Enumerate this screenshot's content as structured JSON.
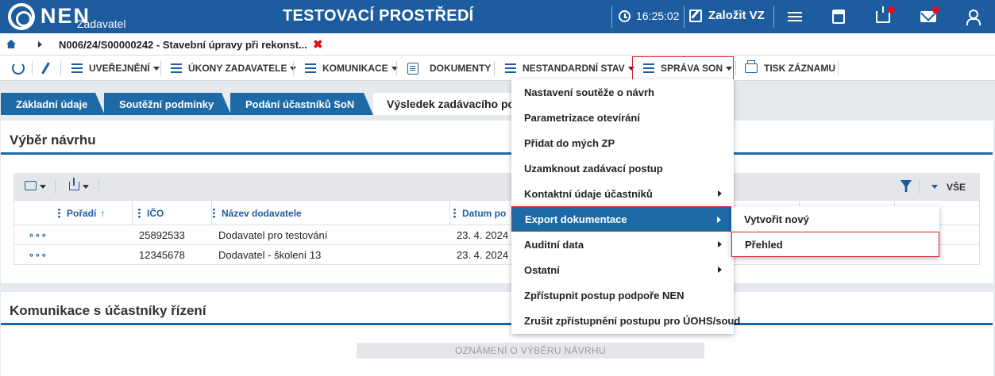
{
  "header": {
    "logo": "NEN",
    "logo_sub": "Zadavatel",
    "env_title": "TESTOVACÍ PROSTŘEDÍ",
    "time": "16:25:02",
    "create_vz": "Založit VZ",
    "icons": [
      "clock-icon",
      "edit-icon",
      "menu-icon",
      "calculator-icon",
      "inbox-icon",
      "mail-icon",
      "user-icon"
    ],
    "accent_color": "#1d5c9e",
    "notification_color": "#e0101c"
  },
  "breadcrumb": {
    "text": "N006/24/S00000242 - Stavební úpravy při rekonst...",
    "close": "✖"
  },
  "toolbar": {
    "uverejneni": "UVEŘEJNĚNÍ",
    "ukony": "ÚKONY ZADAVATELE",
    "komunikace": "KOMUNIKACE",
    "dokumenty": "DOKUMENTY",
    "nestandardni": "NESTANDARDNÍ STAV",
    "sprava": "SPRÁVA SON",
    "tisk": "TISK ZÁZNAMU"
  },
  "tabs": [
    {
      "label": "Základní údaje"
    },
    {
      "label": "Soutěžní podmínky"
    },
    {
      "label": "Podání účastníků SoN"
    },
    {
      "label": "Výsledek zadávacího po"
    }
  ],
  "section1": {
    "title": "Výběr návrhu",
    "filter_all": "VŠE",
    "columns": [
      "Pořadí",
      "IČO",
      "Název dodavatele",
      "Datum po"
    ],
    "rows": [
      {
        "actions": "∘∘∘",
        "ico": "25892533",
        "name": "Dodavatel pro testování",
        "date": "23. 4. 2024"
      },
      {
        "actions": "∘∘∘",
        "ico": "12345678",
        "name": "Dodavatel - školení 13",
        "date": "23. 4. 2024"
      }
    ]
  },
  "section2": {
    "title": "Komunikace s účastníky řízení",
    "button": "OZNÁMENÍ O VÝBĚRU NÁVRHU"
  },
  "menu": {
    "items": [
      {
        "label": "Nastavení soutěže o návrh",
        "arrow": false
      },
      {
        "label": "Parametrizace otevírání",
        "arrow": false
      },
      {
        "label": "Přidat do mých ZP",
        "arrow": false
      },
      {
        "label": "Uzamknout zadávací postup",
        "arrow": false
      },
      {
        "label": "Kontaktní údaje účastníků",
        "arrow": true
      },
      {
        "label": "Export dokumentace",
        "arrow": true
      },
      {
        "label": "Auditní data",
        "arrow": true
      },
      {
        "label": "Ostatní",
        "arrow": true
      },
      {
        "label": "Zpřístupnit postup podpoře NEN",
        "arrow": false
      },
      {
        "label": "Zrušit zpřístupnění postupu pro ÚOHS/soud",
        "arrow": false
      }
    ],
    "submenu": [
      {
        "label": "Vytvořit nový"
      },
      {
        "label": "Přehled"
      }
    ]
  }
}
